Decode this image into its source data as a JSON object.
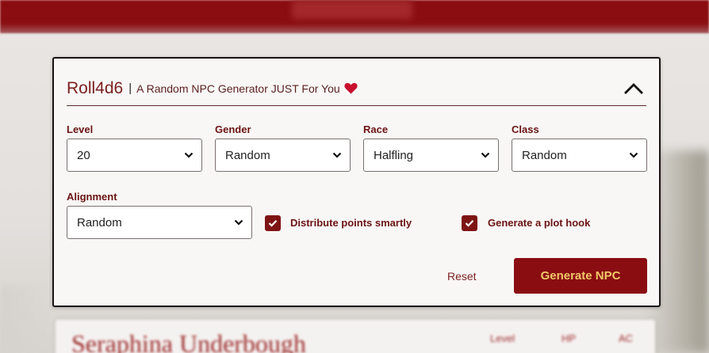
{
  "header": {
    "title": "Roll4d6",
    "separator": "|",
    "subtitle": "A Random NPC Generator JUST For You"
  },
  "fields": {
    "level": {
      "label": "Level",
      "value": "20"
    },
    "gender": {
      "label": "Gender",
      "value": "Random"
    },
    "race": {
      "label": "Race",
      "value": "Halfling"
    },
    "class": {
      "label": "Class",
      "value": "Random"
    },
    "alignment": {
      "label": "Alignment",
      "value": "Random"
    }
  },
  "options": {
    "distribute": {
      "label": "Distribute points smartly",
      "checked": true
    },
    "plot_hook": {
      "label": "Generate a plot hook",
      "checked": true
    }
  },
  "actions": {
    "reset": "Reset",
    "generate": "Generate NPC"
  },
  "result_preview": {
    "name": "Seraphina Underbough",
    "stat_labels": [
      "Level",
      "HP",
      "AC"
    ]
  },
  "colors": {
    "accent": "#8a0d12",
    "button_text": "#f2c86a",
    "label": "#6b1313"
  }
}
